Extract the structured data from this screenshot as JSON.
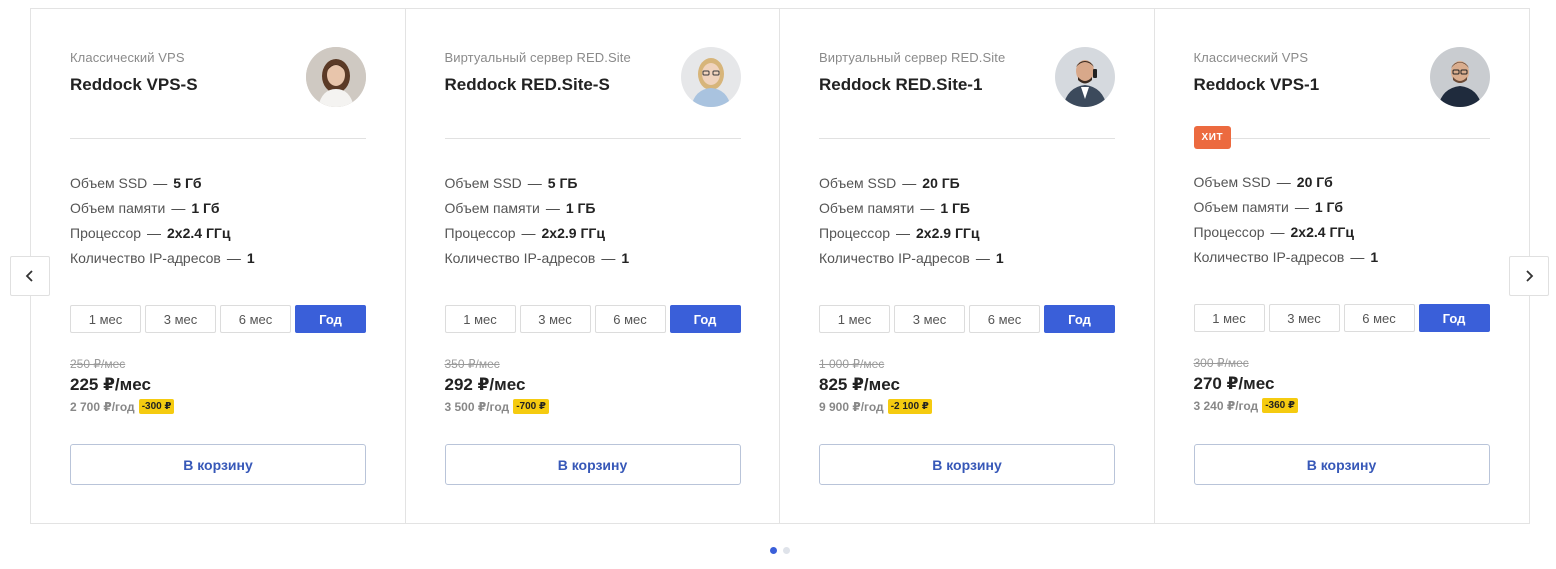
{
  "nav": {
    "prev_icon": "chevron-left-icon",
    "next_icon": "chevron-right-icon"
  },
  "colors": {
    "accent": "#3a5fd9",
    "badge_hit": "#ec6a3f",
    "discount": "#f5cb10",
    "cart_text": "#3758b8"
  },
  "cards": [
    {
      "subtitle": "Классический VPS",
      "name": "Reddock VPS-S",
      "badge": "",
      "specs": [
        {
          "label": "Объем SSD",
          "dash": "—",
          "value": "5 Гб"
        },
        {
          "label": "Объем памяти",
          "dash": "—",
          "value": "1 Гб"
        },
        {
          "label": "Процессор",
          "dash": "—",
          "value": "2x2.4 ГГц"
        },
        {
          "label": "Количество IP-адресов",
          "dash": "—",
          "value": "1"
        }
      ],
      "periods": [
        "1 мес",
        "3 мес",
        "6 мес",
        "Год"
      ],
      "active_period": "Год",
      "old_price": "250 ₽/мес",
      "price": "225 ₽/мес",
      "year_price": "2 700 ₽/год",
      "discount": "-300 ₽",
      "cart_label": "В корзину",
      "avatar": "woman-brown-hair-avatar"
    },
    {
      "subtitle": "Виртуальный сервер RED.Site",
      "name": "Reddock RED.Site-S",
      "badge": "",
      "specs": [
        {
          "label": "Объем SSD",
          "dash": "—",
          "value": "5 ГБ"
        },
        {
          "label": "Объем памяти",
          "dash": "—",
          "value": "1 ГБ"
        },
        {
          "label": "Процессор",
          "dash": "—",
          "value": "2x2.9 ГГц"
        },
        {
          "label": "Количество IP-адресов",
          "dash": "—",
          "value": "1"
        }
      ],
      "periods": [
        "1 мес",
        "3 мес",
        "6 мес",
        "Год"
      ],
      "active_period": "Год",
      "old_price": "350 ₽/мес",
      "price": "292 ₽/мес",
      "year_price": "3 500 ₽/год",
      "discount": "-700 ₽",
      "cart_label": "В корзину",
      "avatar": "woman-blonde-glasses-avatar"
    },
    {
      "subtitle": "Виртуальный сервер RED.Site",
      "name": "Reddock RED.Site-1",
      "badge": "",
      "specs": [
        {
          "label": "Объем SSD",
          "dash": "—",
          "value": "20 ГБ"
        },
        {
          "label": "Объем памяти",
          "dash": "—",
          "value": "1 ГБ"
        },
        {
          "label": "Процессор",
          "dash": "—",
          "value": "2x2.9 ГГц"
        },
        {
          "label": "Количество IP-адресов",
          "dash": "—",
          "value": "1"
        }
      ],
      "periods": [
        "1 мес",
        "3 мес",
        "6 мес",
        "Год"
      ],
      "active_period": "Год",
      "old_price": "1 000 ₽/мес",
      "price": "825 ₽/мес",
      "year_price": "9 900 ₽/год",
      "discount": "-2 100 ₽",
      "cart_label": "В корзину",
      "avatar": "man-suit-phone-avatar"
    },
    {
      "subtitle": "Классический VPS",
      "name": "Reddock VPS-1",
      "badge": "ХИТ",
      "specs": [
        {
          "label": "Объем SSD",
          "dash": "—",
          "value": "20 Гб"
        },
        {
          "label": "Объем памяти",
          "dash": "—",
          "value": "1 Гб"
        },
        {
          "label": "Процессор",
          "dash": "—",
          "value": "2x2.4 ГГц"
        },
        {
          "label": "Количество IP-адресов",
          "dash": "—",
          "value": "1"
        }
      ],
      "periods": [
        "1 мес",
        "3 мес",
        "6 мес",
        "Год"
      ],
      "active_period": "Год",
      "old_price": "300 ₽/мес",
      "price": "270 ₽/мес",
      "year_price": "3 240 ₽/год",
      "discount": "-360 ₽",
      "cart_label": "В корзину",
      "avatar": "man-glasses-dark-sweater-avatar"
    }
  ],
  "pagination": {
    "count": 2,
    "active": 0
  }
}
